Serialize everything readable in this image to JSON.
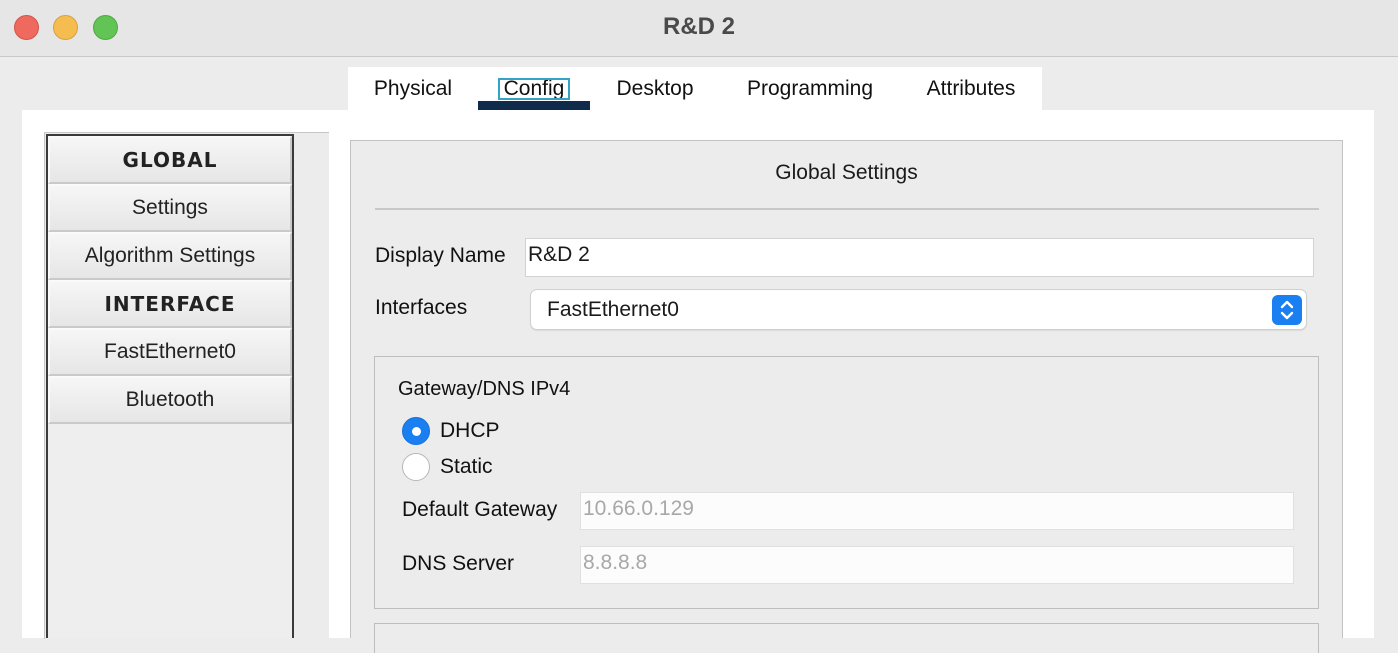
{
  "window": {
    "title": "R&D 2"
  },
  "tabs": [
    {
      "label": "Physical"
    },
    {
      "label": "Config"
    },
    {
      "label": "Desktop"
    },
    {
      "label": "Programming"
    },
    {
      "label": "Attributes"
    }
  ],
  "active_tab": "Config",
  "sidebar": {
    "items": [
      {
        "label": "GLOBAL",
        "type": "header"
      },
      {
        "label": "Settings",
        "type": "item"
      },
      {
        "label": "Algorithm Settings",
        "type": "item"
      },
      {
        "label": "INTERFACE",
        "type": "header"
      },
      {
        "label": "FastEthernet0",
        "type": "item"
      },
      {
        "label": "Bluetooth",
        "type": "item"
      }
    ]
  },
  "global_settings": {
    "title": "Global Settings",
    "display_name_label": "Display Name",
    "display_name_value": "R&D 2",
    "interfaces_label": "Interfaces",
    "interfaces_value": "FastEthernet0",
    "gateway_dns": {
      "title": "Gateway/DNS IPv4",
      "dhcp_label": "DHCP",
      "static_label": "Static",
      "selected": "DHCP",
      "default_gateway_label": "Default Gateway",
      "default_gateway_value": "10.66.0.129",
      "dns_server_label": "DNS Server",
      "dns_server_value": "8.8.8.8"
    }
  },
  "colors": {
    "accent": "#1a7ff0",
    "active_tab_underline": "#0f2a4a",
    "close": "#ee6a5f",
    "minimize": "#f5bd4f",
    "maximize": "#61c454"
  }
}
